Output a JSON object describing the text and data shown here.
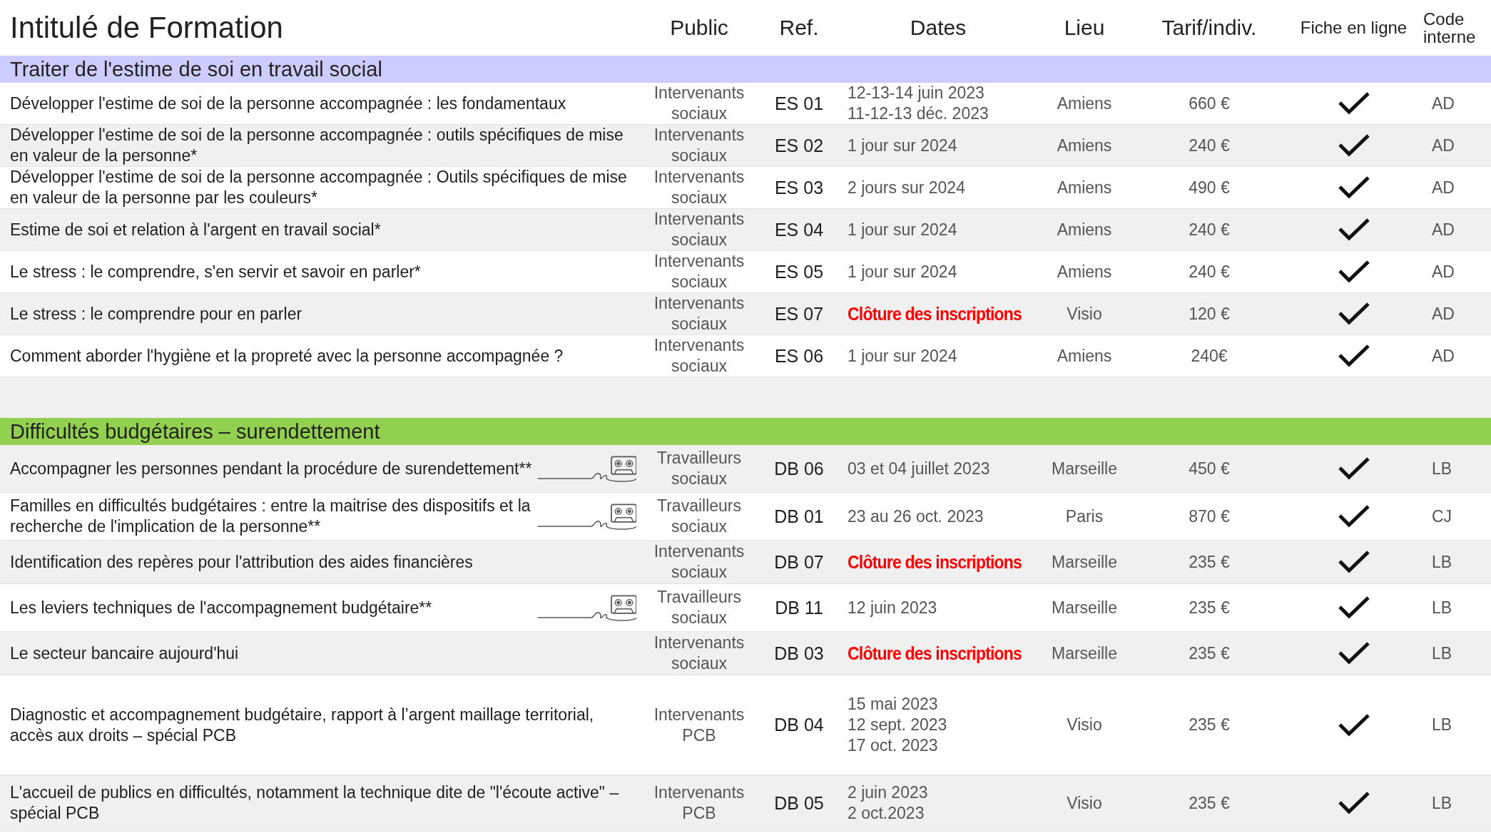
{
  "header": {
    "title": "Intitulé de Formation",
    "columns": [
      "Public",
      "Ref.",
      "Dates",
      "Lieu",
      "Tarif/indiv.",
      "Fiche en ligne",
      "Code interne"
    ]
  },
  "sections": [
    {
      "title": "Traiter de l'estime de soi en travail social",
      "color": "#ccccff",
      "rows": [
        {
          "title": "Développer l'estime de soi de la personne accompagnée : les fondamentaux",
          "public": "Intervenants sociaux",
          "ref": "ES 01",
          "kind": "dates",
          "dates": [
            "12-13-14 juin 2023",
            "11-12-13 déc. 2023"
          ],
          "lieu": "Amiens",
          "tarif": "660 €",
          "online": true,
          "code": "AD",
          "shaded": false,
          "cassette": false
        },
        {
          "title": "Développer l'estime de soi de la personne accompagnée : outils spécifiques de mise en valeur de la personne*",
          "public": "Intervenants sociaux",
          "ref": "ES 02",
          "kind": "dates",
          "dates": [
            "1 jour sur 2024"
          ],
          "lieu": "Amiens",
          "tarif": "240 €",
          "online": true,
          "code": "AD",
          "shaded": true,
          "cassette": false
        },
        {
          "title": "Développer l'estime de soi de la personne accompagnée : Outils spécifiques de mise en valeur de la personne par les couleurs*",
          "public": "Intervenants sociaux",
          "ref": "ES 03",
          "kind": "dates",
          "dates": [
            "2 jours sur 2024"
          ],
          "lieu": "Amiens",
          "tarif": "490 €",
          "online": true,
          "code": "AD",
          "shaded": false,
          "cassette": false
        },
        {
          "title": "Estime de soi et relation à l'argent en travail social*",
          "public": "Intervenants sociaux",
          "ref": "ES 04",
          "kind": "dates",
          "dates": [
            "1 jour sur 2024"
          ],
          "lieu": "Amiens",
          "tarif": "240 €",
          "online": true,
          "code": "AD",
          "shaded": true,
          "cassette": false
        },
        {
          "title": "Le stress : le comprendre, s'en servir et savoir en parler*",
          "public": "Intervenants sociaux",
          "ref": "ES 05",
          "kind": "dates",
          "dates": [
            "1 jour sur 2024"
          ],
          "lieu": "Amiens",
          "tarif": "240 €",
          "online": true,
          "code": "AD",
          "shaded": false,
          "cassette": false
        },
        {
          "title": "Le stress : le comprendre pour en parler",
          "public": "Intervenants sociaux",
          "ref": "ES 07",
          "kind": "closed",
          "dates": [
            "Clôture des inscriptions"
          ],
          "lieu": "Visio",
          "tarif": "120 €",
          "online": true,
          "code": "AD",
          "shaded": true,
          "cassette": false
        },
        {
          "title": "Comment aborder l'hygiène et la propreté avec la personne accompagnée ?",
          "public": "Intervenants sociaux",
          "ref": "ES 06",
          "kind": "dates",
          "dates": [
            "1 jour sur 2024"
          ],
          "lieu": "Amiens",
          "tarif": "240€",
          "online": true,
          "code": "AD",
          "shaded": false,
          "cassette": false
        }
      ]
    },
    {
      "title": "Difficultés budgétaires – surendettement",
      "color": "#92d050",
      "rows": [
        {
          "title": "Accompagner les personnes pendant la procédure de surendettement**",
          "public": "Travailleurs sociaux",
          "ref": "DB 06",
          "kind": "dates",
          "dates": [
            "03 et 04 juillet 2023"
          ],
          "lieu": "Marseille",
          "tarif": "450 €",
          "online": true,
          "code": "LB",
          "shaded": true,
          "cassette": true
        },
        {
          "title": "Familles en difficultés budgétaires : entre la maitrise des dispositifs et la recherche de l'implication de la personne**",
          "public": "Travailleurs sociaux",
          "ref": "DB 01",
          "kind": "dates",
          "dates": [
            "23 au 26 oct. 2023"
          ],
          "lieu": "Paris",
          "tarif": "870 €",
          "online": true,
          "code": "CJ",
          "shaded": false,
          "cassette": true
        },
        {
          "title": "Identification des repères pour l'attribution des aides financières",
          "public": "Intervenants sociaux",
          "ref": "DB 07",
          "kind": "closed",
          "dates": [
            "Clôture des inscriptions"
          ],
          "lieu": "Marseille",
          "tarif": "235 €",
          "online": true,
          "code": "LB",
          "shaded": true,
          "cassette": false
        },
        {
          "title": "Les leviers techniques de l'accompagnement budgétaire**",
          "public": "Travailleurs sociaux",
          "ref": "DB 11",
          "kind": "dates",
          "dates": [
            "12 juin 2023"
          ],
          "lieu": "Marseille",
          "tarif": "235 €",
          "online": true,
          "code": "LB",
          "shaded": false,
          "cassette": true
        },
        {
          "title": "Le secteur bancaire aujourd'hui",
          "public": "Intervenants sociaux",
          "ref": "DB 03",
          "kind": "closed",
          "dates": [
            "Clôture des inscriptions"
          ],
          "lieu": "Marseille",
          "tarif": "235 €",
          "online": true,
          "code": "LB",
          "shaded": true,
          "cassette": false
        },
        {
          "title": "Diagnostic et accompagnement budgétaire, rapport à l’argent maillage territorial, accès aux droits – spécial PCB",
          "public": "Intervenants PCB",
          "ref": "DB 04",
          "kind": "dates",
          "dates": [
            "15 mai 2023",
            "12 sept. 2023",
            "17 oct. 2023"
          ],
          "lieu": "Visio",
          "tarif": "235 €",
          "online": true,
          "code": "LB",
          "shaded": false,
          "cassette": false
        },
        {
          "title": "L'accueil de publics en difficultés, notamment la technique dite de \"l'écoute active\" – spécial PCB",
          "public": "Intervenants PCB",
          "ref": "DB 05",
          "kind": "dates",
          "dates": [
            "2 juin 2023",
            "2 oct.2023"
          ],
          "lieu": "Visio",
          "tarif": "235 €",
          "online": true,
          "code": "LB",
          "shaded": true,
          "cassette": false
        }
      ]
    }
  ]
}
